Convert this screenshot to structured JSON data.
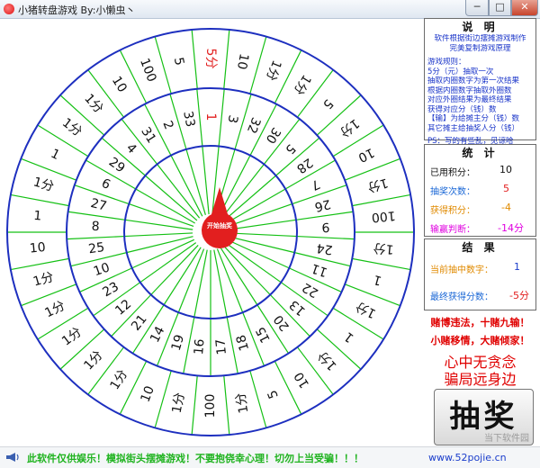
{
  "window": {
    "title": "小猪转盘游戏 By:小懒虫丶",
    "minimize_label": "─",
    "maximize_label": "□",
    "close_label": "✕"
  },
  "wheel": {
    "outer_ring": [
      "5分",
      "10",
      "1分",
      "1分",
      "5",
      "1分",
      "10",
      "1分",
      "100",
      "1分",
      "1",
      "1分",
      "1",
      "1分",
      "10",
      "5",
      "1分",
      "100",
      "1分",
      "10",
      "1分",
      "1分",
      "1分",
      "1分",
      "1分",
      "10",
      "1",
      "1分",
      "1",
      "1分",
      "1分",
      "10",
      "100",
      "5"
    ],
    "inner_ring": [
      "1",
      "3",
      "32",
      "30",
      "5",
      "28",
      "7",
      "26",
      "9",
      "24",
      "11",
      "22",
      "13",
      "20",
      "15",
      "18",
      "17",
      "16",
      "19",
      "14",
      "21",
      "12",
      "23",
      "10",
      "25",
      "8",
      "27",
      "6",
      "29",
      "4",
      "31",
      "2",
      "33"
    ],
    "hub_label": "开始抽奖"
  },
  "help": {
    "title": "说  明",
    "lines": [
      "软件根据街边摆摊游戏制作",
      "完美复制游戏原理",
      "",
      "游戏规则：",
      "5分（元）抽取一次",
      "抽取内圈数字为第一次结果",
      "根据内圈数字抽取外圈数",
      "对应外圈结果为最终结果",
      "获得对应分（钱）数",
      "【输】为给摊主分（钱）数",
      "其它摊主给抽奖人分（钱）"
    ],
    "footer": "PS：写的有些乱，见谅哈"
  },
  "stats": {
    "title": "统  计",
    "used_label": "已用积分：",
    "used_value": "10",
    "count_label": "抽奖次数：",
    "count_value": "5",
    "gain_label": "获得积分：",
    "gain_value": "-4",
    "win_label": "输赢判断：",
    "win_value": "-14分",
    "colors": {
      "used": "#111111",
      "count": "#1a67d6",
      "gain": "#e08a00",
      "win": "#e000e0"
    }
  },
  "result": {
    "title": "结  果",
    "current_label": "当前抽中数字：",
    "current_value": "1",
    "final_label": "最终获得分数：",
    "final_value": "-5分",
    "colors": {
      "current": "#e08a00",
      "final": "#1a67d6"
    }
  },
  "slogans": {
    "line1": "赌博违法，十赌九输！",
    "line2": "小赌移情，大赌倾家！",
    "line3": "心中无贪念",
    "line4": "骗局远身边"
  },
  "draw_button": {
    "label": "抽奖"
  },
  "status": {
    "message": "此软件仅供娱乐！模拟街头摆摊游戏！不要抱侥幸心理！切勿上当受骗！！！",
    "url": "www.52pojie.cn",
    "watermark": "当下软件园"
  }
}
